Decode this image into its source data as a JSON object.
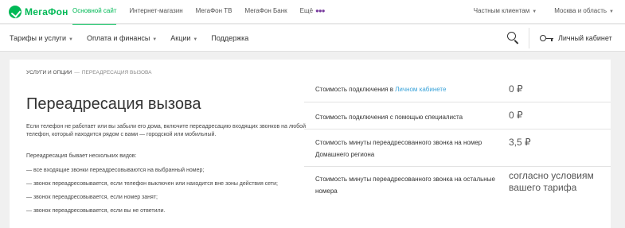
{
  "brand": {
    "logo_text": "МегаФон",
    "accent": "#00b956"
  },
  "topbar": {
    "links": [
      "Основной сайт",
      "Интернет-магазин",
      "МегаФон ТВ",
      "МегаФон Банк",
      "Ещё"
    ],
    "active_index": 0,
    "right": [
      "Частным клиентам",
      "Москва и область"
    ]
  },
  "mainnav": {
    "items": [
      "Тарифы и услуги",
      "Оплата и финансы",
      "Акции",
      "Поддержка"
    ],
    "cabinet_label": "Личный кабинет"
  },
  "breadcrumb": {
    "parent": "Услуги и опции",
    "separator": "—",
    "current": "Переадресация вызова"
  },
  "page": {
    "title": "Переадресация вызова",
    "intro": "Если телефон не работает или вы забыли его дома, включите переадресацию входящих звонков на любой телефон, который находится рядом с вами — городской или мобильный.",
    "kinds_title": "Переадресация бывает нескольких видов:",
    "kinds": [
      "—  все входящие звонки переадресовываются на выбранный номер;",
      "—  звонок переадресовывается, если телефон выключен или находится вне зоны действия сети;",
      "—  звонок переадресовывается, если номер занят;",
      "—  звонок переадресовывается, если вы не ответили."
    ]
  },
  "prices": {
    "rows": [
      {
        "label_prefix": "Стоимость подключения в ",
        "label_link": "Личном кабинете",
        "value": "0 ₽"
      },
      {
        "label": "Стоимость подключения с помощью специалиста",
        "value": "0 ₽"
      },
      {
        "label": "Стоимость минуты переадресованного звонка на номер Домашнего региона",
        "value": "3,5 ₽"
      },
      {
        "label": "Стоимость минуты переадресованного звонка на остальные номера",
        "value": "согласно условиям вашего тарифа"
      }
    ]
  }
}
